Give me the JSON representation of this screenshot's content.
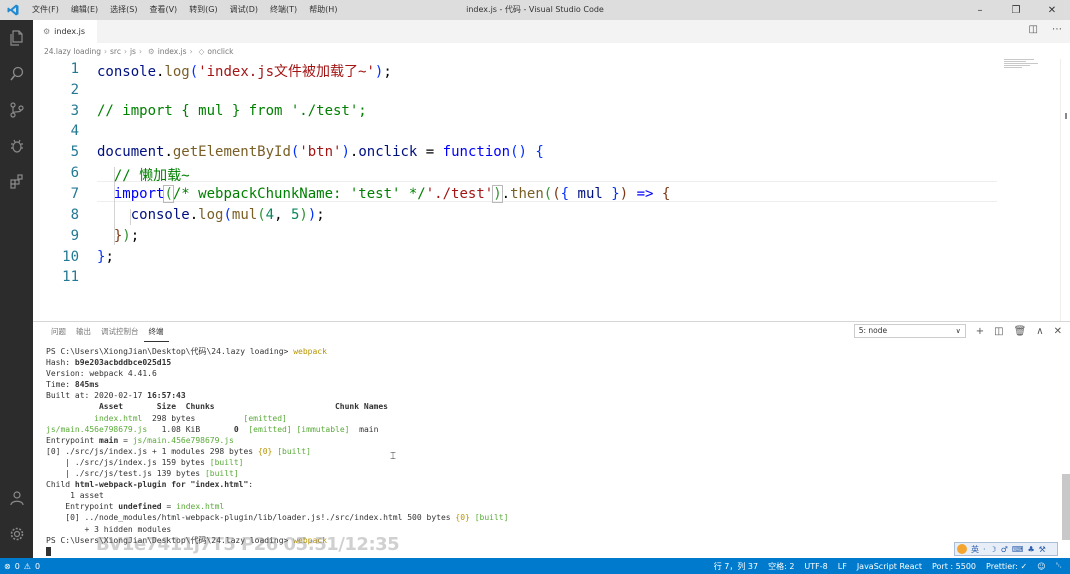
{
  "titlebar": {
    "menu": [
      "文件(F)",
      "编辑(E)",
      "选择(S)",
      "查看(V)",
      "转到(G)",
      "调试(D)",
      "终端(T)",
      "帮助(H)"
    ],
    "title": "index.js - 代码 - Visual Studio Code"
  },
  "tab": {
    "label": "index.js"
  },
  "breadcrumb": [
    "24.lazy loading",
    "src",
    "js",
    "index.js",
    "onclick"
  ],
  "editor": {
    "line_numbers": [
      "1",
      "2",
      "3",
      "4",
      "5",
      "6",
      "7",
      "8",
      "9",
      "10",
      "11"
    ]
  },
  "panel": {
    "tabs": [
      "问题",
      "输出",
      "调试控制台",
      "终端"
    ],
    "active_tab": "终端",
    "terminal_select": "5: node",
    "terminal": {
      "prompt1": "PS C:\\Users\\XiongJian\\Desktop\\代码\\24.lazy loading>",
      "cmd": "webpack",
      "hash_label": "Hash:",
      "hash": "b9e203acbddbce025d15",
      "version": "Version: webpack 4.41.6",
      "time_label": "Time:",
      "time": "845ms",
      "built_label": "Built at: 2020-02-17",
      "built_time": "16:57:43",
      "col_header": "           Asset       Size  Chunks                         Chunk Names",
      "row1_name": "index.html",
      "row1_size": "  298 bytes",
      "row1_status": "[emitted]",
      "row2_name": "js/main.456e798679.js",
      "row2_size": "   1.08 KiB",
      "row2_chunk": "0",
      "row2_status": "[emitted] [immutable]",
      "row2_chunkname": "main",
      "entry_label": "Entrypoint",
      "entry_main": "main",
      "entry_eq": " = ",
      "entry_file": "js/main.456e798679.js",
      "mod0_a": "[0] ./src/js/index.js + 1 modules 298 bytes ",
      "mod0_b": "{0}",
      "mod0_c": "[built]",
      "mod1_a": "    | ./src/js/index.js 159 bytes ",
      "mod1_b": "[built]",
      "mod2_a": "    | ./src/js/test.js 139 bytes ",
      "mod2_b": "[built]",
      "child_a": "Child ",
      "child_b": "html-webpack-plugin for \"index.html\"",
      "child_c": ":",
      "asset1": "     1 asset",
      "entry2_a": "    Entrypoint ",
      "entry2_b": "undefined",
      "entry2_c": " = ",
      "entry2_d": "index.html",
      "loader_a": "    [0] ../node_modules/html-webpack-plugin/lib/loader.js!./src/index.html 500 bytes ",
      "loader_b": "{0}",
      "loader_c": "[built]",
      "hidden": "        + 3 hidden modules",
      "prompt2": "PS C:\\Users\\XiongJian\\Desktop\\代码\\24.lazy loading>",
      "cmd2": "webpack"
    }
  },
  "watermark": "BV1e7411j7T5 P26 05:51/12:35",
  "ime": {
    "lang": "英"
  },
  "statusbar": {
    "errors": "0",
    "warnings": "0",
    "position": "行 7，列 37",
    "spaces": "空格: 2",
    "encoding": "UTF-8",
    "eol": "LF",
    "language": "JavaScript React",
    "port": "Port : 5500",
    "prettier": "Prettier: ✓"
  },
  "colors": {
    "activitybar": "#2c2c2c",
    "statusbar": "#007acc",
    "keyword": "#0000ff",
    "string": "#a31515",
    "comment": "#008000"
  }
}
